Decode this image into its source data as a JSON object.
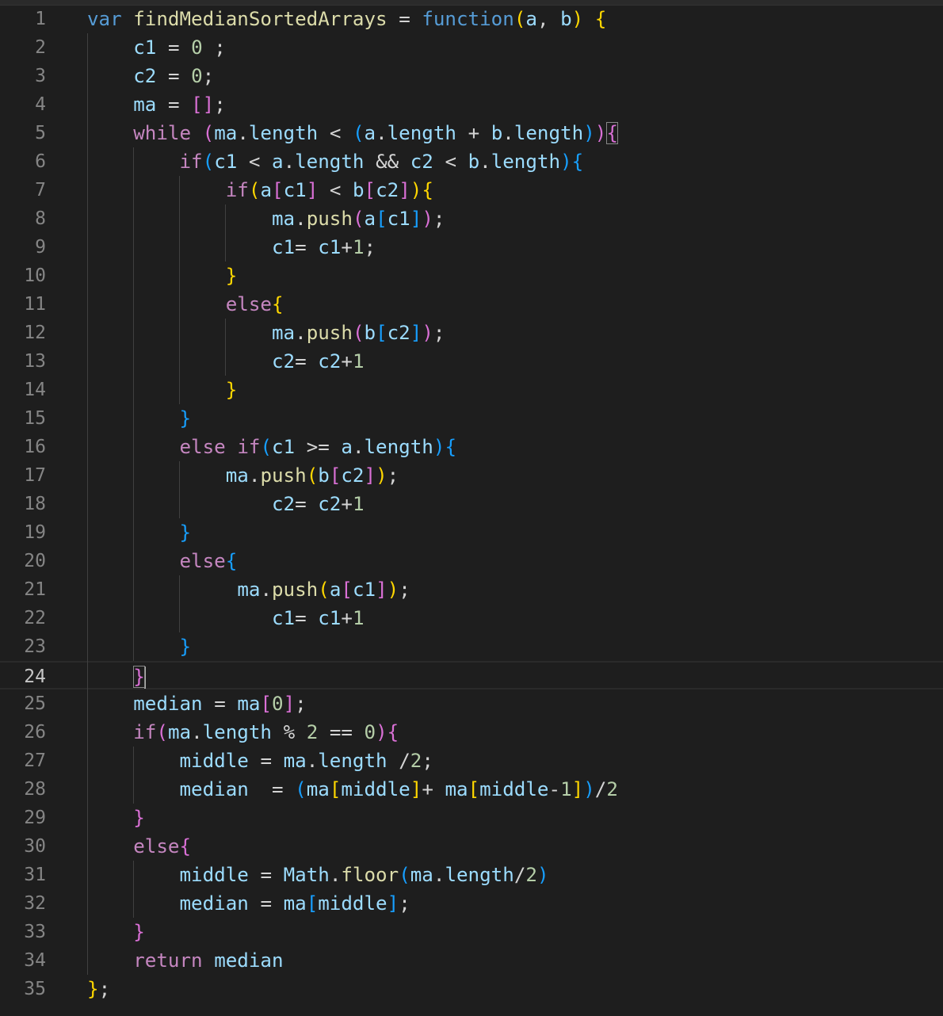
{
  "editor": {
    "language": "javascript",
    "theme": "dark",
    "active_line": 24,
    "colors": {
      "background": "#1e1e1e",
      "line_number": "#858585",
      "keyword": "#569cd6",
      "control": "#c586c0",
      "function": "#dcdcaa",
      "variable": "#9cdcfe",
      "number": "#b5cea8",
      "bracket_1": "#ffd700",
      "bracket_2": "#da70d6",
      "bracket_3": "#179fff"
    },
    "lines": [
      {
        "n": "1",
        "text": "var findMedianSortedArrays = function(a, b) {"
      },
      {
        "n": "2",
        "text": "    c1 = 0 ;"
      },
      {
        "n": "3",
        "text": "    c2 = 0;"
      },
      {
        "n": "4",
        "text": "    ma = [];"
      },
      {
        "n": "5",
        "text": "    while (ma.length < (a.length + b.length)){"
      },
      {
        "n": "6",
        "text": "        if(c1 < a.length && c2 < b.length){"
      },
      {
        "n": "7",
        "text": "            if(a[c1] < b[c2]){"
      },
      {
        "n": "8",
        "text": "                ma.push(a[c1]);"
      },
      {
        "n": "9",
        "text": "                c1= c1+1;"
      },
      {
        "n": "10",
        "text": "            }"
      },
      {
        "n": "11",
        "text": "            else{"
      },
      {
        "n": "12",
        "text": "                ma.push(b[c2]);"
      },
      {
        "n": "13",
        "text": "                c2= c2+1"
      },
      {
        "n": "14",
        "text": "            }"
      },
      {
        "n": "15",
        "text": "        }"
      },
      {
        "n": "16",
        "text": "        else if(c1 >= a.length){"
      },
      {
        "n": "17",
        "text": "            ma.push(b[c2]);"
      },
      {
        "n": "18",
        "text": "                c2= c2+1"
      },
      {
        "n": "19",
        "text": "        }"
      },
      {
        "n": "20",
        "text": "        else{"
      },
      {
        "n": "21",
        "text": "             ma.push(a[c1]);"
      },
      {
        "n": "22",
        "text": "                c1= c1+1"
      },
      {
        "n": "23",
        "text": "        }"
      },
      {
        "n": "24",
        "text": "    }"
      },
      {
        "n": "25",
        "text": "    median = ma[0];"
      },
      {
        "n": "26",
        "text": "    if(ma.length % 2 == 0){"
      },
      {
        "n": "27",
        "text": "        middle = ma.length /2;"
      },
      {
        "n": "28",
        "text": "        median  = (ma[middle]+ ma[middle-1])/2"
      },
      {
        "n": "29",
        "text": "    }"
      },
      {
        "n": "30",
        "text": "    else{"
      },
      {
        "n": "31",
        "text": "        middle = Math.floor(ma.length/2)"
      },
      {
        "n": "32",
        "text": "        median = ma[middle];"
      },
      {
        "n": "33",
        "text": "    }"
      },
      {
        "n": "34",
        "text": "    return median"
      },
      {
        "n": "35",
        "text": "};"
      }
    ]
  }
}
